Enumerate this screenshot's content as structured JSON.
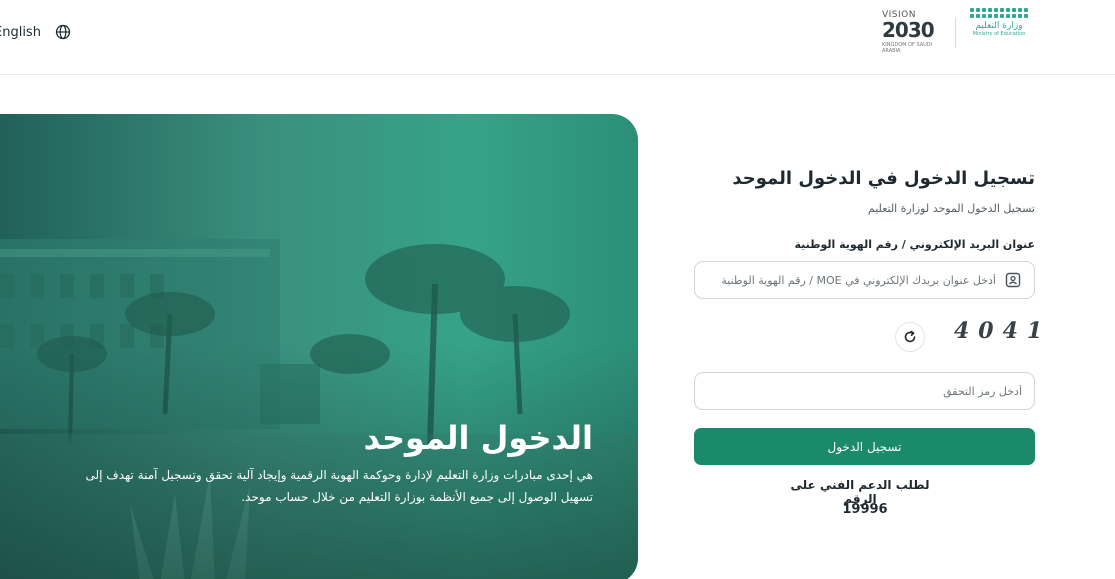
{
  "header": {
    "language_label": "English",
    "vision": {
      "title": "VISION",
      "year": "2030",
      "subtitle": "KINGDOM OF SAUDI ARABIA"
    },
    "ministry": {
      "name_ar": "وزارة التعليم",
      "name_en": "Ministry of Education"
    }
  },
  "hero": {
    "title": "الدخول الموحد",
    "description": "هي إحدى مبادرات وزارة التعليم لإدارة وحوكمة الهوية الرقمية وإيجاد آلية تحقق وتسجيل آمنة تهدف إلى تسهيل الوصول إلى جميع الأنظمة بوزارة التعليم من خلال حساب موحد."
  },
  "form": {
    "title": "تسجيل الدخول في الدخول الموحد",
    "subtitle": "تسجيل الدخول الموحد لوزارة التعليم",
    "email_label": "عنوان البريد الإلكتروني / رقم الهوية الوطنية",
    "email_placeholder": "أدخل عنوان بريدك الإلكتروني في MOE / رقم الهوية الوطنية",
    "captcha_code": "4041",
    "otp_placeholder": "أدخل رمز التحقق",
    "login_button": "تسجيل الدخول",
    "support_text": "لطلب الدعم الفني على الرقم",
    "support_number": "19996"
  },
  "colors": {
    "primary": "#1b8a6b",
    "hero_teal": "#36a389",
    "text": "#1f2a30"
  },
  "icons": {
    "language": "globe-icon",
    "id_card": "id-card-icon",
    "refresh": "refresh-icon"
  }
}
